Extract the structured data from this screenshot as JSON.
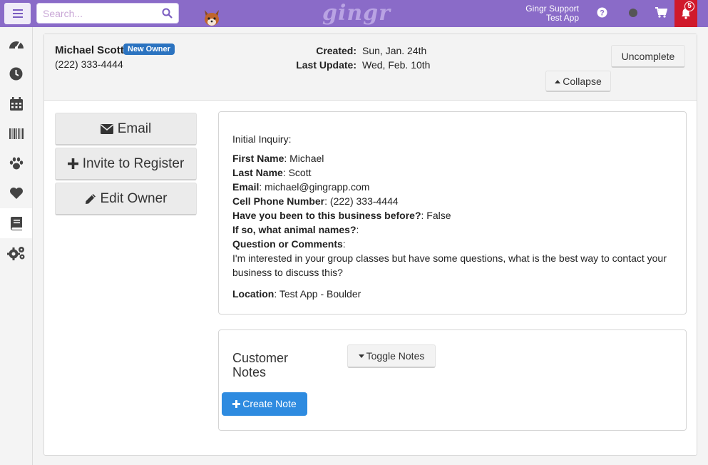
{
  "topbar": {
    "search_placeholder": "Search...",
    "logo": "gingr",
    "user_name": "Gingr Support",
    "user_location": "Test App",
    "notification_count": "5",
    "colors": {
      "bar": "#8a6bc8",
      "alert": "#d0192b"
    }
  },
  "sidebar": {
    "items": [
      {
        "icon": "dashboard-icon"
      },
      {
        "icon": "clock-icon"
      },
      {
        "icon": "calendar-icon"
      },
      {
        "icon": "barcode-icon"
      },
      {
        "icon": "paw-icon"
      },
      {
        "icon": "heart-icon"
      },
      {
        "icon": "book-icon",
        "active": true
      },
      {
        "icon": "gears-icon"
      }
    ]
  },
  "owner": {
    "name": "Michael Scott",
    "badge": "New Owner",
    "phone": "(222) 333-4444",
    "created_label": "Created:",
    "created_value": "Sun, Jan. 24th",
    "updated_label": "Last Update:",
    "updated_value": "Wed, Feb. 10th"
  },
  "header_actions": {
    "uncomplete": "Uncomplete",
    "collapse": "Collapse"
  },
  "actions": {
    "email": "Email",
    "invite": "Invite to Register",
    "edit": "Edit Owner"
  },
  "inquiry": {
    "intro": "Initial Inquiry:",
    "fields": [
      {
        "label": "First Name",
        "value": ": Michael"
      },
      {
        "label": "Last Name",
        "value": ": Scott"
      },
      {
        "label": "Email",
        "value": ": michael@gingrapp.com"
      },
      {
        "label": "Cell Phone Number",
        "value": ": (222) 333-4444"
      },
      {
        "label": "Have you been to this business before?",
        "value": ": False"
      },
      {
        "label": "If so, what animal names?",
        "value": ":"
      },
      {
        "label": "Question or Comments",
        "value": ":"
      }
    ],
    "comment": "I'm interested in your group classes but have some questions, what is the best way to contact your business to discuss this?",
    "location_label": "Location",
    "location_value": ": Test App - Boulder"
  },
  "notes": {
    "title": "Customer Notes",
    "toggle": "Toggle Notes",
    "create": "Create Note"
  }
}
